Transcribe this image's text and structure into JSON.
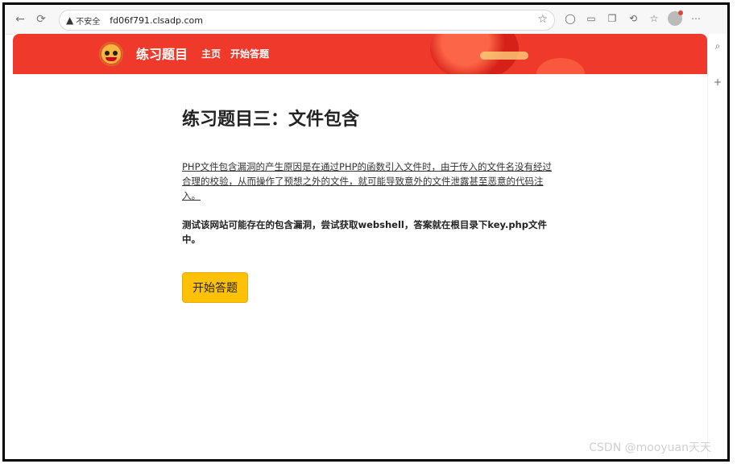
{
  "browser": {
    "security_label": "不安全",
    "url": "fd06f791.clsadp.com"
  },
  "site": {
    "title": "练习题目",
    "nav": [
      "主页",
      "开始答题"
    ]
  },
  "main": {
    "heading": "练习题目三：文件包含",
    "description": "PHP文件包含漏洞的产生原因是在通过PHP的函数引入文件时，由于传入的文件名没有经过合理的校验，从而操作了预想之外的文件，就可能导致意外的文件泄露甚至恶意的代码注入。",
    "task": "测试该网站可能存在的包含漏洞，尝试获取webshell，答案就在根目录下key.php文件中。",
    "start_button": "开始答题"
  },
  "watermark": "CSDN @mooyuan天天",
  "colors": {
    "banner": "#ef3a2b",
    "button": "#ffc107"
  },
  "icons": [
    "back-arrow-icon",
    "reload-icon",
    "warning-icon",
    "star-icon",
    "extensions-icon",
    "profile-avatar-icon",
    "menu-icon",
    "search-icon",
    "plus-icon"
  ]
}
